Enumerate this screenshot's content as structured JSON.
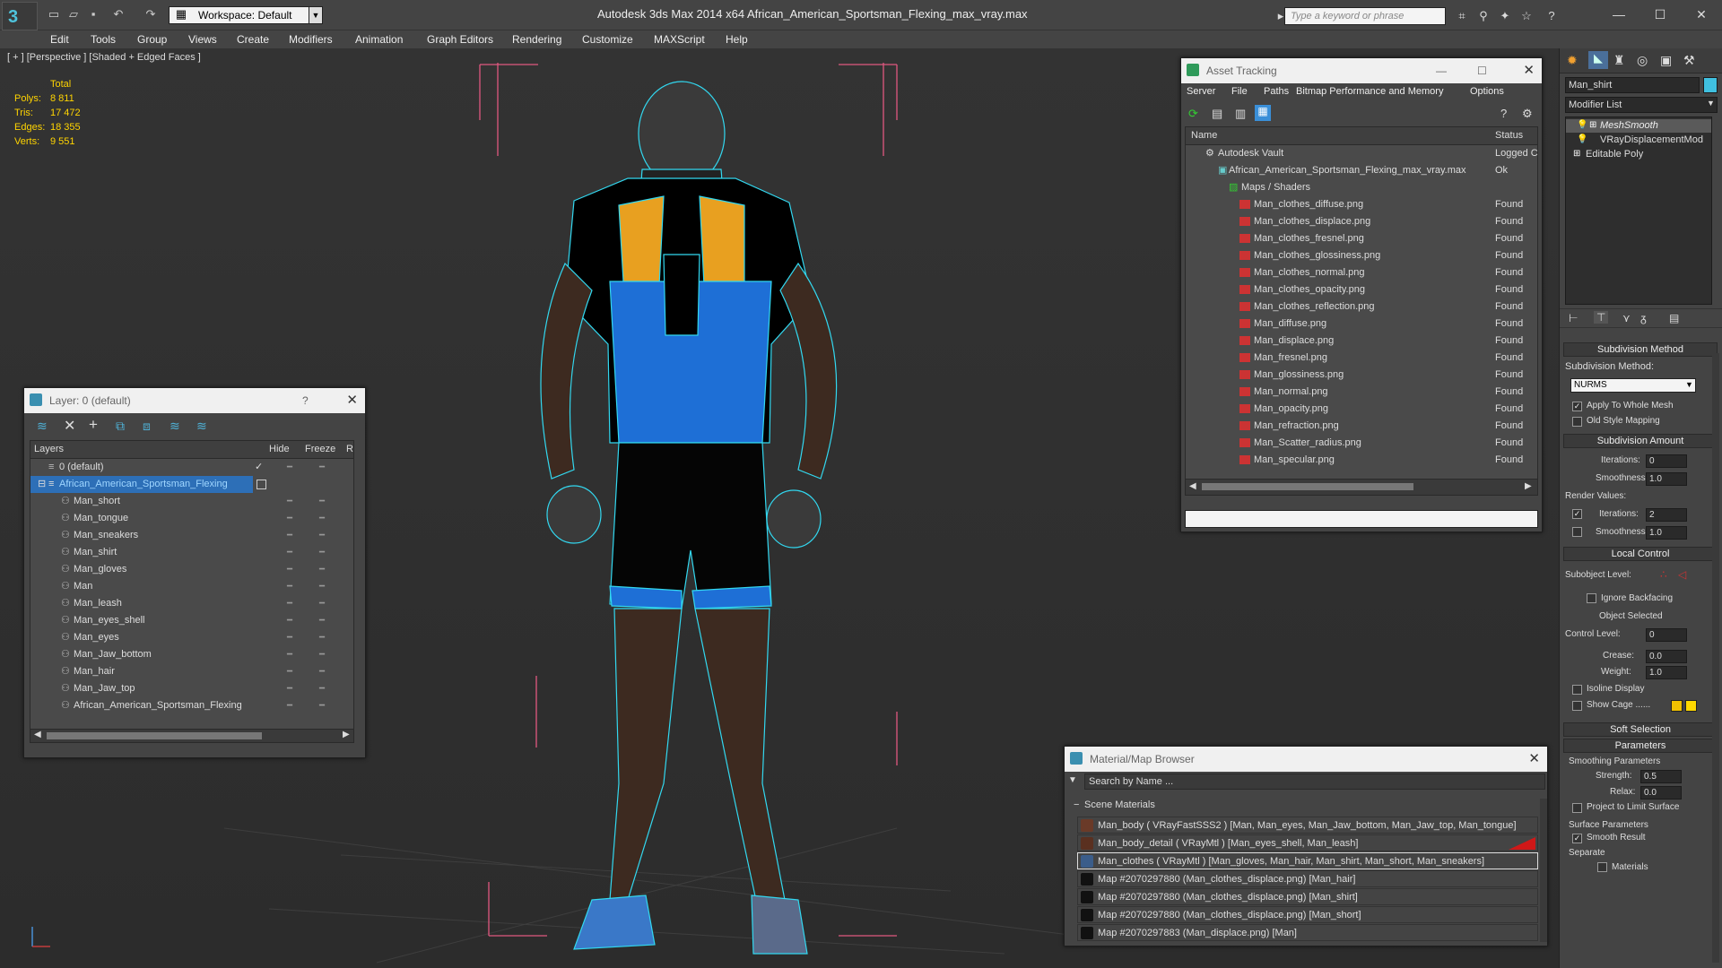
{
  "app": {
    "title": "Autodesk 3ds Max  2014 x64     African_American_Sportsman_Flexing_max_vray.max",
    "workspace": "Workspace: Default",
    "search_placeholder": "Type a keyword or phrase"
  },
  "menu": [
    "Edit",
    "Tools",
    "Group",
    "Views",
    "Create",
    "Modifiers",
    "Animation",
    "Graph Editors",
    "Rendering",
    "Customize",
    "MAXScript",
    "Help"
  ],
  "viewport": {
    "label": "[ + ] [Perspective ] [Shaded + Edged Faces ]",
    "stats": {
      "total": "Total",
      "polys_label": "Polys:",
      "polys": "8 811",
      "tris_label": "Tris:",
      "tris": "17 472",
      "edges_label": "Edges:",
      "edges": "18 355",
      "verts_label": "Verts:",
      "verts": "9 551"
    }
  },
  "layer_panel": {
    "title": "Layer: 0 (default)",
    "help": "?",
    "col_layers": "Layers",
    "col_hide": "Hide",
    "col_freeze": "Freeze",
    "col_r": "R",
    "rows": [
      "0 (default)",
      "African_American_Sportsman_Flexing",
      "Man_short",
      "Man_tongue",
      "Man_sneakers",
      "Man_shirt",
      "Man_gloves",
      "Man",
      "Man_leash",
      "Man_eyes_shell",
      "Man_eyes",
      "Man_Jaw_bottom",
      "Man_hair",
      "Man_Jaw_top",
      "African_American_Sportsman_Flexing"
    ]
  },
  "asset_tracking": {
    "title": "Asset Tracking",
    "menu": [
      "Server",
      "File",
      "Paths",
      "Bitmap Performance and Memory",
      "Options"
    ],
    "col_name": "Name",
    "col_status": "Status",
    "rows": [
      {
        "name": "Autodesk Vault",
        "status": "Logged C"
      },
      {
        "name": "African_American_Sportsman_Flexing_max_vray.max",
        "status": "Ok"
      },
      {
        "name": "Maps / Shaders",
        "status": ""
      },
      {
        "name": "Man_clothes_diffuse.png",
        "status": "Found"
      },
      {
        "name": "Man_clothes_displace.png",
        "status": "Found"
      },
      {
        "name": "Man_clothes_fresnel.png",
        "status": "Found"
      },
      {
        "name": "Man_clothes_glossiness.png",
        "status": "Found"
      },
      {
        "name": "Man_clothes_normal.png",
        "status": "Found"
      },
      {
        "name": "Man_clothes_opacity.png",
        "status": "Found"
      },
      {
        "name": "Man_clothes_reflection.png",
        "status": "Found"
      },
      {
        "name": "Man_diffuse.png",
        "status": "Found"
      },
      {
        "name": "Man_displace.png",
        "status": "Found"
      },
      {
        "name": "Man_fresnel.png",
        "status": "Found"
      },
      {
        "name": "Man_glossiness.png",
        "status": "Found"
      },
      {
        "name": "Man_normal.png",
        "status": "Found"
      },
      {
        "name": "Man_opacity.png",
        "status": "Found"
      },
      {
        "name": "Man_refraction.png",
        "status": "Found"
      },
      {
        "name": "Man_Scatter_radius.png",
        "status": "Found"
      },
      {
        "name": "Man_specular.png",
        "status": "Found"
      }
    ]
  },
  "material_browser": {
    "title": "Material/Map Browser",
    "search_placeholder": "Search by Name ...",
    "section": "Scene Materials",
    "rows": [
      "Man_body  ( VRayFastSSS2 ) [Man, Man_eyes, Man_Jaw_bottom, Man_Jaw_top, Man_tongue]",
      "Man_body_detail  ( VRayMtl ) [Man_eyes_shell, Man_leash]",
      "Man_clothes  ( VRayMtl ) [Man_gloves, Man_hair, Man_shirt, Man_short, Man_sneakers]",
      "Map #2070297880 (Man_clothes_displace.png) [Man_hair]",
      "Map #2070297880 (Man_clothes_displace.png) [Man_shirt]",
      "Map #2070297880 (Man_clothes_displace.png) [Man_short]",
      "Map #2070297883 (Man_displace.png) [Man]"
    ]
  },
  "command_panel": {
    "object_name": "Man_shirt",
    "modifier_list": "Modifier List",
    "stack": [
      "MeshSmooth",
      "VRayDisplacementMod",
      "Editable Poly"
    ],
    "subdiv_method_title": "Subdivision Method",
    "subdiv_method_label": "Subdivision Method:",
    "subdiv_method_value": "NURMS",
    "apply_whole": "Apply To Whole Mesh",
    "old_style": "Old Style Mapping",
    "subdiv_amount_title": "Subdivision Amount",
    "iterations": "Iterations:",
    "iterations_val": "0",
    "smoothness": "Smoothness:",
    "smoothness_val": "1.0",
    "render_values": "Render Values:",
    "r_iterations": "Iterations:",
    "r_iterations_val": "2",
    "r_smoothness": "Smoothness:",
    "r_smoothness_val": "1.0",
    "local_control_title": "Local Control",
    "subobject_level": "Subobject Level:",
    "ignore_backfacing": "Ignore Backfacing",
    "object_selected": "Object Selected",
    "control_level": "Control Level:",
    "control_level_val": "0",
    "crease": "Crease:",
    "crease_val": "0.0",
    "weight": "Weight:",
    "weight_val": "1.0",
    "isoline": "Isoline Display",
    "show_cage": "Show Cage ......",
    "soft_selection_title": "Soft Selection",
    "parameters_title": "Parameters",
    "smoothing_params": "Smoothing Parameters",
    "strength": "Strength:",
    "strength_val": "0.5",
    "relax": "Relax:",
    "relax_val": "0.0",
    "project_limit": "Project to Limit Surface",
    "surface_params": "Surface Parameters",
    "smooth_result": "Smooth Result",
    "separate": "Separate",
    "materials": "Materials"
  }
}
